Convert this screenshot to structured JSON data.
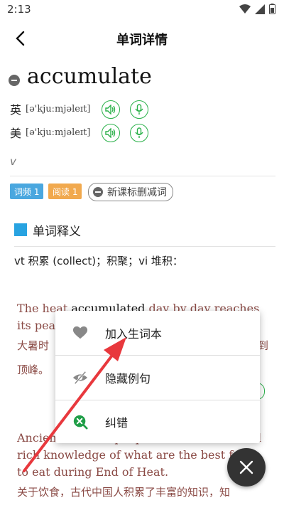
{
  "status": {
    "time": "2:13"
  },
  "header": {
    "title": "单词详情"
  },
  "word": {
    "headword": "accumulate",
    "uk_label": "英",
    "uk_phonetic": "[ə'kjuːmjəleɪt]",
    "us_label": "美",
    "us_phonetic": "[ə'kjuːmjəleɪt]",
    "pos": "v"
  },
  "tags": {
    "freq": "词频 1",
    "read": "阅读 1",
    "remove": "新课标删减词"
  },
  "section": {
    "title": "单词释义"
  },
  "definition": "vt 积累 (collect)；积聚；vi 堆积：",
  "examples": {
    "ex1_en_l1_pre": "The heat ",
    "ex1_en_l1_word": "accumulated",
    "ex1_en_l1_post": " day by day reaches",
    "ex1_en_l2": "its pea",
    "ex1_cn_l1a": "大暑时",
    "ex1_cn_l1b": "到",
    "ex1_cn_l2": "顶峰。",
    "ex2_en_l1": "Ancient Chinese people have accumulated",
    "ex2_en_l2": "rich knowledge of what are the best f",
    "ex2_en_l3": "to eat during End of Heat.",
    "ex2_cn_l1": "关于饮食，古代中国人积累了丰富的知识，知"
  },
  "menu": {
    "items": [
      {
        "label": "加入生词本",
        "icon": "heart-icon"
      },
      {
        "label": "隐藏例句",
        "icon": "eye-slash-icon"
      },
      {
        "label": "纠错",
        "icon": "correct-icon"
      }
    ]
  },
  "colors": {
    "green": "#2bb14a",
    "blue": "#28a3e1",
    "orange": "#f1a94e",
    "arrow": "#e8383d"
  }
}
